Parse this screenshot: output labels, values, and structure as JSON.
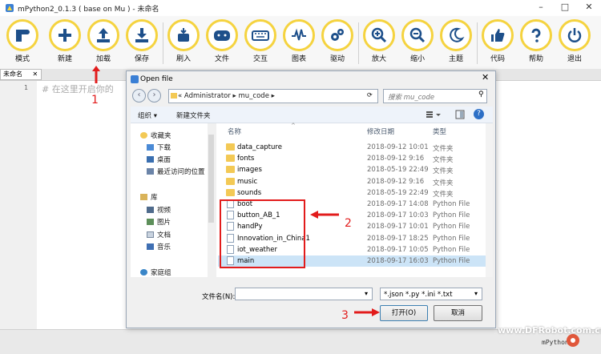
{
  "window": {
    "title": "mPython2_0.1.3 ( base on Mu ) - 未命名",
    "controls": [
      "–",
      "□",
      "✕"
    ]
  },
  "toolbar": [
    {
      "label": "模式",
      "icon": "mode-icon"
    },
    {
      "label": "新建",
      "icon": "plus-icon"
    },
    {
      "label": "加载",
      "icon": "upload-icon"
    },
    {
      "label": "保存",
      "icon": "download-icon"
    },
    {
      "label": "刷入",
      "icon": "flash-icon"
    },
    {
      "label": "文件",
      "icon": "board-icon"
    },
    {
      "label": "交互",
      "icon": "keyboard-icon"
    },
    {
      "label": "图表",
      "icon": "pulse-icon"
    },
    {
      "label": "驱动",
      "icon": "gears-icon"
    },
    {
      "label": "放大",
      "icon": "zoom-in-icon"
    },
    {
      "label": "缩小",
      "icon": "zoom-out-icon"
    },
    {
      "label": "主题",
      "icon": "moon-icon"
    },
    {
      "label": "代码",
      "icon": "thumbs-up-icon"
    },
    {
      "label": "帮助",
      "icon": "question-icon"
    },
    {
      "label": "退出",
      "icon": "power-icon"
    }
  ],
  "tab": {
    "label": "未命名",
    "close": "✕"
  },
  "editor": {
    "line_number": "1",
    "comment": "#  在这里开启你的"
  },
  "status": {
    "logo": "mPython"
  },
  "watermark": "www.DFRobot.com.cn",
  "dialog": {
    "title": "Open file",
    "close": "✕",
    "address": "«  Administrator  ▸  mu_code  ▸",
    "search_placeholder": "搜索 mu_code",
    "organize": "组织 ▾",
    "new_folder": "新建文件夹",
    "nav": {
      "favorites_header": "收藏夹",
      "favorites": [
        "下载",
        "桌面",
        "最近访问的位置"
      ],
      "library_header": "库",
      "libraries": [
        "视频",
        "图片",
        "文档",
        "音乐"
      ],
      "homegroup": "家庭组"
    },
    "columns": {
      "name": "名称",
      "date": "修改日期",
      "type": "类型"
    },
    "files": [
      {
        "name": "data_capture",
        "date": "2018-09-12 10:01",
        "type": "文件夹",
        "kind": "folder"
      },
      {
        "name": "fonts",
        "date": "2018-09-12 9:16",
        "type": "文件夹",
        "kind": "folder"
      },
      {
        "name": "images",
        "date": "2018-05-19 22:49",
        "type": "文件夹",
        "kind": "folder"
      },
      {
        "name": "music",
        "date": "2018-09-12 9:16",
        "type": "文件夹",
        "kind": "folder"
      },
      {
        "name": "sounds",
        "date": "2018-05-19 22:49",
        "type": "文件夹",
        "kind": "folder"
      },
      {
        "name": "boot",
        "date": "2018-09-17 14:08",
        "type": "Python File",
        "kind": "py"
      },
      {
        "name": "button_AB_1",
        "date": "2018-09-17 10:03",
        "type": "Python File",
        "kind": "py"
      },
      {
        "name": "handPy",
        "date": "2018-09-17 10:01",
        "type": "Python File",
        "kind": "py"
      },
      {
        "name": "Innovation_in_China1",
        "date": "2018-09-17 18:25",
        "type": "Python File",
        "kind": "py"
      },
      {
        "name": "iot_weather",
        "date": "2018-09-17 10:05",
        "type": "Python File",
        "kind": "py"
      },
      {
        "name": "main",
        "date": "2018-09-17 16:03",
        "type": "Python File",
        "kind": "py",
        "selected": true
      }
    ],
    "filename_label": "文件名(N):",
    "filename_value": "",
    "filter": "*.json *.py *.ini *.txt",
    "open_button": "打开(O)",
    "cancel_button": "取消"
  },
  "annotations": {
    "step1": "1",
    "step2": "2",
    "step3": "3"
  },
  "colors": {
    "accent_ring": "#f5d33f",
    "annotation": "#e21c1c",
    "selection": "#cce4f7"
  }
}
